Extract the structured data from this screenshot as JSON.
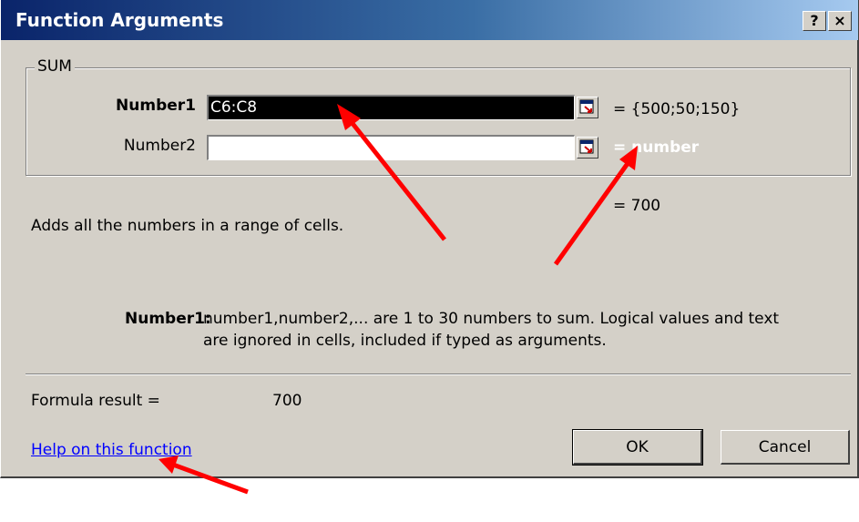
{
  "dialog": {
    "title": "Function Arguments",
    "help_button": "?",
    "close_button": "×"
  },
  "function": {
    "name": "SUM",
    "args": [
      {
        "label": "Number1",
        "value": "C6:C8",
        "result": "= {500;50;150}"
      },
      {
        "label": "Number2",
        "value": "",
        "result": "= number"
      }
    ],
    "result_inline": "= 700",
    "description": "Adds all the numbers in a range of cells.",
    "arg_help_label": "Number1:",
    "arg_help_line1": "number1,number2,... are 1 to 30 numbers to sum. Logical values and text",
    "arg_help_line2": "are ignored in cells, included if typed as arguments."
  },
  "formula_result": {
    "label": "Formula result =",
    "value": "700"
  },
  "help_link": "Help on this function",
  "buttons": {
    "ok": "OK",
    "cancel": "Cancel"
  },
  "colors": {
    "dialog_bg": "#d4d0c8",
    "titlebar_start": "#0a246a",
    "titlebar_end": "#a6caf0",
    "annotation_arrow": "#ff0000",
    "link": "#0000ff"
  }
}
